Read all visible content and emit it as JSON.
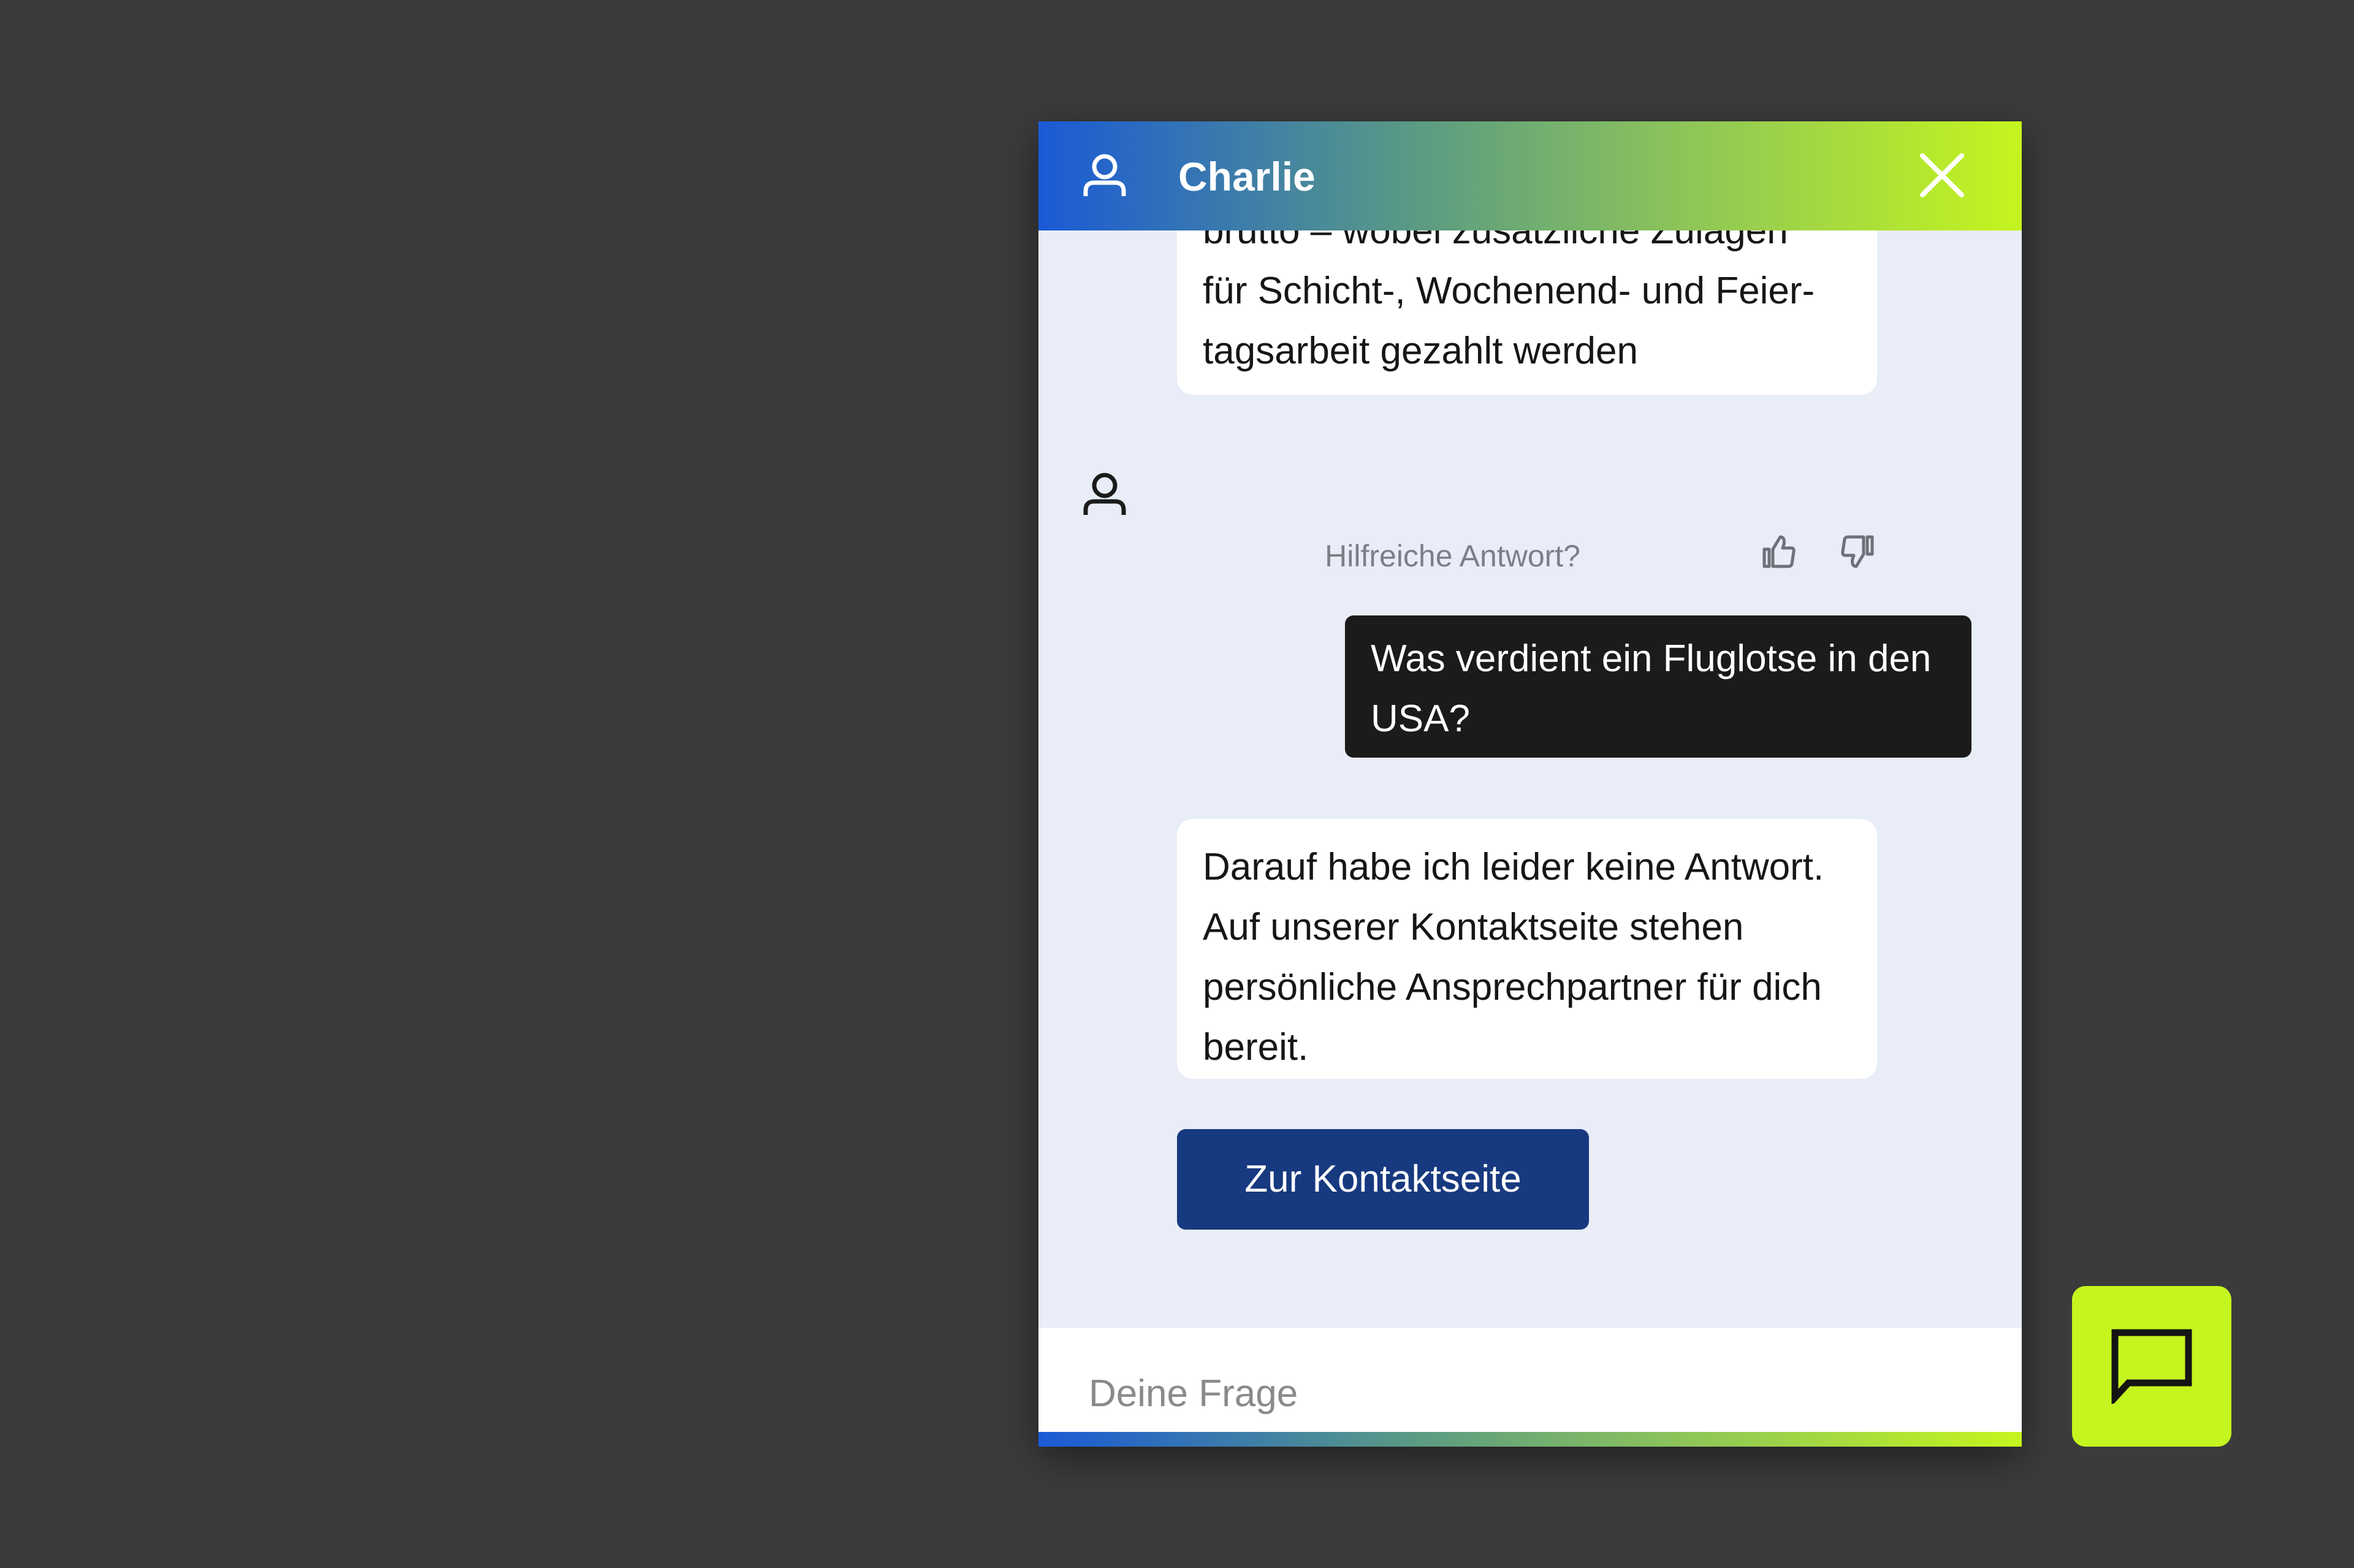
{
  "header": {
    "title": "Charlie"
  },
  "messages": {
    "bot_partial": {
      "line_clipped": "brutto – wobei zusätzliche Zulagen",
      "line_2": "für Schicht-, Wochenend- und Feier-",
      "line_3": "tagsarbeit gezahlt werden"
    },
    "feedback": {
      "label": "Hilfreiche Antwort?"
    },
    "user_question": "Was verdient ein Fluglotse in den USA?",
    "bot_reply": "Darauf habe ich leider keine Ant­wort. Auf unserer Kontaktseite stehen persönliche Ansprechpartner für dich bereit.",
    "contact_button_label": "Zur Kontaktseite"
  },
  "input": {
    "placeholder": "Deine Frage",
    "value": ""
  },
  "icons": {
    "header_avatar": "user-icon",
    "close": "close-icon",
    "bot_avatar": "user-icon",
    "thumbs_up": "thumbs-up-icon",
    "thumbs_down": "thumbs-down-icon",
    "launcher": "chat-bubble-icon"
  },
  "colors": {
    "background": "#3b3b3b",
    "chat_background": "#e8edf7",
    "gradient_start": "#1a5ad6",
    "gradient_end": "#c5f51e",
    "user_bubble": "#1b1b1b",
    "button": "#17397f",
    "launcher": "#c5f51e"
  }
}
